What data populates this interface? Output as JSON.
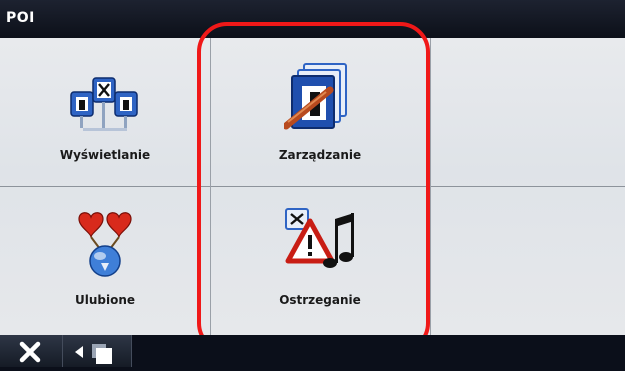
{
  "header": {
    "title": "POI"
  },
  "tiles": [
    {
      "label": "Wyświetlanie"
    },
    {
      "label": "Zarządzanie"
    },
    {
      "label": "Ulubione"
    },
    {
      "label": "Ostrzeganie"
    }
  ],
  "footer": {
    "close_icon": "close-icon",
    "back_icon": "back-icon"
  },
  "colors": {
    "highlight": "#f01818",
    "panel": "#e4e7ea",
    "bar": "#0b0f1a"
  }
}
